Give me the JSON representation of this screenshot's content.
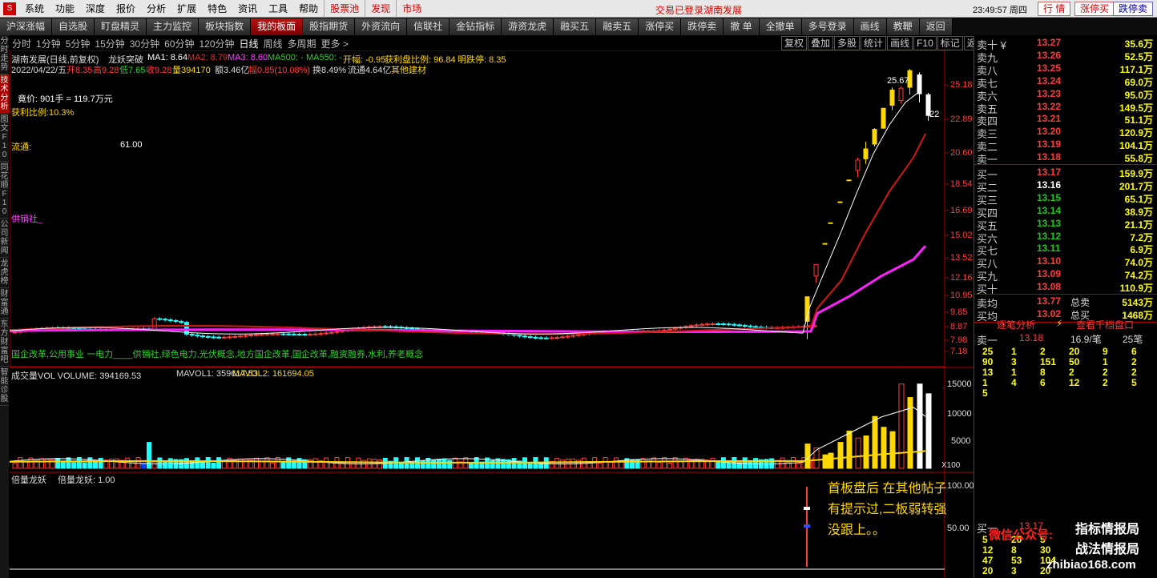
{
  "menubar": {
    "logo": "S",
    "items": [
      "系统",
      "功能",
      "深度",
      "报价",
      "分析",
      "扩展",
      "特色",
      "资讯",
      "工具",
      "帮助"
    ],
    "special": [
      "股票池",
      "发现",
      "市场"
    ],
    "login_status": "交易已登录",
    "stock_title": "湖南发展",
    "clock": "23:49:57 周四",
    "buttons": [
      "行 情",
      "涨停买",
      "跌停卖"
    ]
  },
  "toolbar": {
    "buttons": [
      "沪深涨幅",
      "自选股",
      "盯盘精灵",
      "主力监控",
      "板块指数",
      "我的板面",
      "股指期货",
      "外资流向",
      "信联社",
      "金钻指标",
      "游资龙虎",
      "融买五",
      "融卖五",
      "涨停买",
      "跌停卖",
      "撤 单",
      "全撤单",
      "多号登录",
      "画线",
      "教鞭",
      "返回"
    ],
    "active_index": 5
  },
  "left_tabs": [
    "分时走势",
    "技术分析",
    "图文F10",
    "同花顺F10",
    "公司新闻",
    "龙虎榜",
    "财富通",
    "东方财富吧",
    "智能诊股"
  ],
  "left_tabs_active": 1,
  "period_bar": {
    "items": [
      "分时",
      "1分钟",
      "5分钟",
      "15分钟",
      "30分钟",
      "60分钟",
      "120分钟",
      "日线",
      "周线",
      "多周期",
      "更多 >"
    ],
    "active_index": 7
  },
  "right_buttons": [
    "复权",
    "叠加",
    "多股",
    "统计",
    "画线",
    "F10",
    "标记",
    "返回"
  ],
  "main_header": {
    "line1_name": "湖南发展(日线,前复权)",
    "line1_indicator": "龙妖突破",
    "ma1": "MA1: 8.64",
    "ma2": "MA2: 8.79",
    "ma3": "MA3: 8.60",
    "ma500": "MA500: -",
    "ma550": "MA550: -",
    "kaifu": "开幅: -0.95",
    "profit_ratio": "获利盘比例: 96.84",
    "limit": "明跌停: 8.35",
    "line2_date": "2022/04/22/五",
    "line2_open": "开8.35",
    "line2_high": "高9.28",
    "line2_low": "低7.65",
    "line2_close": "收9.28",
    "line2_vol": "量394170",
    "line2_amount": "额3.46亿",
    "line2_change": "幅0.85(10.08%)",
    "line2_turnover": "换8.49%",
    "line2_float": "流通4.64亿",
    "line2_other": "其他建材"
  },
  "overlay": {
    "bid": "竟价: 901手 = 119.7万元",
    "profit": "获利比例:10.3%",
    "float_label": "流通:",
    "float_value": "61.00",
    "supply": "供销社_",
    "concept": "国企改革,公用事业 一电力____供销社,绿色电力,光伏概念,地方国企改革,国企改革,融资融券,水利,养老概念",
    "peak_label": "25.67",
    "close_label": "22"
  },
  "price_axis": [
    "25.18",
    "22.89",
    "20.60",
    "18.54",
    "16.69",
    "15.02",
    "13.52",
    "12.16",
    "10.95",
    "9.85",
    "8.87",
    "7.98",
    "7.18"
  ],
  "volume_panel": {
    "title": "成交量VOL VOLUME: 394169.53",
    "mavol1": "MAVOL1: 359617.53",
    "mavol2": "MAVOL2: 161694.05",
    "axis": [
      "15000",
      "10000",
      "5000"
    ],
    "unit": "X100"
  },
  "bottom_panel": {
    "title": "倍量龙妖",
    "value": "倍量龙妖: 1.00",
    "axis": [
      "100.00",
      "50.00"
    ],
    "annotation": [
      "首板盘后 在其他帖子",
      "有提示过,二板弱转强",
      "没跟上。。"
    ]
  },
  "orderbook": {
    "sells": [
      {
        "label": "卖十 ¥",
        "price": "13.27",
        "vol": "35.6万"
      },
      {
        "label": "卖九",
        "price": "13.26",
        "vol": "52.5万"
      },
      {
        "label": "卖八",
        "price": "13.25",
        "vol": "117.1万"
      },
      {
        "label": "卖七",
        "price": "13.24",
        "vol": "69.0万"
      },
      {
        "label": "卖六",
        "price": "13.23",
        "vol": "95.0万"
      },
      {
        "label": "卖五",
        "price": "13.22",
        "vol": "149.5万"
      },
      {
        "label": "卖四",
        "price": "13.21",
        "vol": "51.1万"
      },
      {
        "label": "卖三",
        "price": "13.20",
        "vol": "120.9万"
      },
      {
        "label": "卖二",
        "price": "13.19",
        "vol": "104.1万"
      },
      {
        "label": "卖一",
        "price": "13.18",
        "vol": "55.8万"
      }
    ],
    "buys": [
      {
        "label": "买一",
        "price": "13.17",
        "vol": "159.9万"
      },
      {
        "label": "买二",
        "price": "13.16",
        "vol": "201.7万"
      },
      {
        "label": "买三",
        "price": "13.15",
        "vol": "65.1万"
      },
      {
        "label": "买四",
        "price": "13.14",
        "vol": "38.9万"
      },
      {
        "label": "买五",
        "price": "13.13",
        "vol": "21.1万"
      },
      {
        "label": "买六",
        "price": "13.12",
        "vol": "7.2万"
      },
      {
        "label": "买七",
        "price": "13.11",
        "vol": "6.9万"
      },
      {
        "label": "买八",
        "price": "13.10",
        "vol": "74.0万"
      },
      {
        "label": "买九",
        "price": "13.09",
        "vol": "74.2万"
      },
      {
        "label": "买十",
        "price": "13.08",
        "vol": "110.9万"
      }
    ],
    "avg_sell": {
      "label": "卖均",
      "price": "13.77",
      "total_label": "总卖",
      "total": "5143万"
    },
    "avg_buy": {
      "label": "买均",
      "price": "13.02",
      "total_label": "总买",
      "total": "1468万"
    },
    "tabs": [
      "逐笔分析",
      "查看千档盘口"
    ],
    "first_sell_row": {
      "label": "卖一",
      "price": "13.18",
      "per": "16.9/笔",
      "count": "25笔"
    },
    "detail_rows": [
      [
        "25",
        "1",
        "2",
        "20",
        "9",
        "6"
      ],
      [
        "90",
        "3",
        "151",
        "50",
        "1",
        "2"
      ],
      [
        "13",
        "1",
        "8",
        "2",
        "2",
        "2"
      ],
      [
        "1",
        "4",
        "6",
        "12",
        "2",
        "5"
      ],
      [
        "5",
        "",
        "",
        "",
        "",
        ""
      ]
    ],
    "bottom_label": "买一",
    "bottom_price": "13.17",
    "bottom_rows": [
      [
        "5",
        "20",
        "5"
      ],
      [
        "12",
        "8",
        "30"
      ],
      [
        "47",
        "53",
        "104"
      ],
      [
        "20",
        "3",
        "20"
      ]
    ],
    "watermark1": "微信公众号:",
    "watermark2": "指标情报局",
    "watermark3": "战法情报局",
    "watermark4": "zhibiao168.com"
  },
  "colors": {
    "up": "#ff3c3c",
    "down": "#22ffff",
    "yellow": "#ffd800",
    "ma_white": "#ffffff",
    "ma_red": "#d01818",
    "ma_magenta": "#ff20ff"
  }
}
